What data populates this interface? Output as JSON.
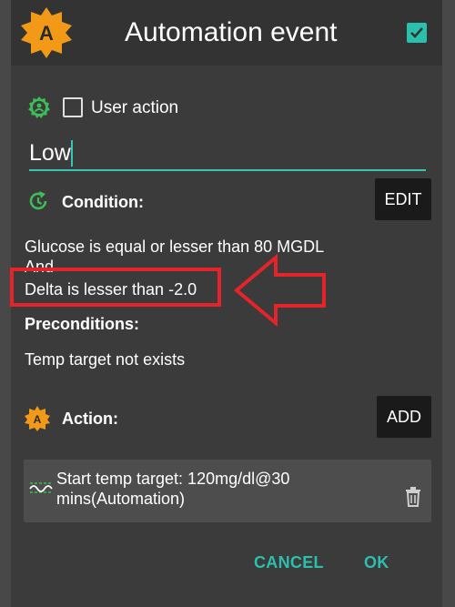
{
  "dialog": {
    "title": "Automation event",
    "title_checked": true,
    "app_icon_letter": "A"
  },
  "user_action": {
    "label": "User action",
    "checked": false
  },
  "event_name": {
    "value": "Low"
  },
  "condition": {
    "label": "Condition:",
    "edit_label": "EDIT",
    "lines": [
      "Glucose is equal or lesser than 80 MGDL",
      "And",
      "Delta is lesser than -2.0"
    ]
  },
  "preconditions": {
    "label": "Preconditions:",
    "lines": [
      "Temp target not exists"
    ]
  },
  "action": {
    "label": "Action:",
    "add_label": "ADD",
    "icon_letter": "A",
    "items": [
      {
        "text": "Start temp target: 120mg/dl@30 mins(Automation)"
      }
    ]
  },
  "footer": {
    "cancel_label": "CANCEL",
    "ok_label": "OK"
  },
  "colors": {
    "accent": "#2bbfae",
    "icon_orange": "#f29a18",
    "icon_green": "#3dbd58",
    "highlight_red": "#e5232b"
  },
  "icons": {
    "app": "automation-logo-icon",
    "user_action": "user-settings-gear-icon",
    "condition": "clock-refresh-icon",
    "action": "automation-logo-icon",
    "action_item": "temp-target-icon",
    "delete": "trash-icon"
  }
}
